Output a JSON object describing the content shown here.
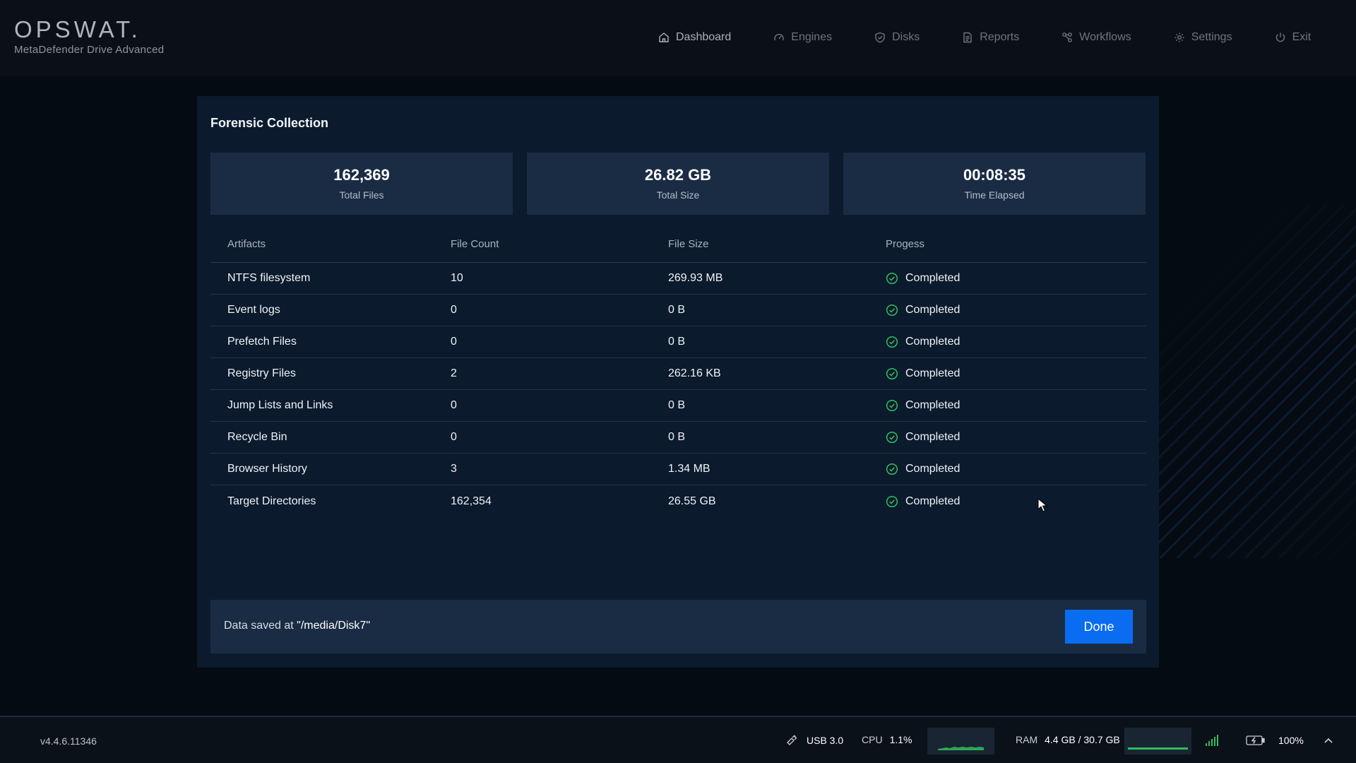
{
  "brand": {
    "logo": "OPSWAT.",
    "product": "MetaDefender Drive Advanced"
  },
  "nav": [
    {
      "label": "Dashboard",
      "icon": "home-icon"
    },
    {
      "label": "Engines",
      "icon": "gauge-icon"
    },
    {
      "label": "Disks",
      "icon": "shield-check-icon"
    },
    {
      "label": "Reports",
      "icon": "document-icon"
    },
    {
      "label": "Workflows",
      "icon": "workflow-icon"
    },
    {
      "label": "Settings",
      "icon": "gear-icon"
    },
    {
      "label": "Exit",
      "icon": "power-icon"
    }
  ],
  "panel": {
    "title": "Forensic Collection",
    "stats": [
      {
        "value": "162,369",
        "label": "Total Files"
      },
      {
        "value": "26.82 GB",
        "label": "Total Size"
      },
      {
        "value": "00:08:35",
        "label": "Time Elapsed"
      }
    ],
    "columns": [
      "Artifacts",
      "File Count",
      "File Size",
      "Progess"
    ],
    "rows": [
      {
        "artifact": "NTFS filesystem",
        "count": "10",
        "size": "269.93 MB",
        "status": "Completed"
      },
      {
        "artifact": "Event logs",
        "count": "0",
        "size": "0 B",
        "status": "Completed"
      },
      {
        "artifact": "Prefetch Files",
        "count": "0",
        "size": "0 B",
        "status": "Completed"
      },
      {
        "artifact": "Registry Files",
        "count": "2",
        "size": "262.16 KB",
        "status": "Completed"
      },
      {
        "artifact": "Jump Lists and Links",
        "count": "0",
        "size": "0 B",
        "status": "Completed"
      },
      {
        "artifact": "Recycle Bin",
        "count": "0",
        "size": "0 B",
        "status": "Completed"
      },
      {
        "artifact": "Browser History",
        "count": "3",
        "size": "1.34 MB",
        "status": "Completed"
      },
      {
        "artifact": "Target Directories",
        "count": "162,354",
        "size": "26.55 GB",
        "status": "Completed"
      }
    ],
    "saved_prefix": "Data saved at ",
    "saved_path": "\"/media/Disk7\"",
    "done_label": "Done"
  },
  "statusbar": {
    "version": "v4.4.6.11346",
    "usb": "USB 3.0",
    "cpu_label": "CPU",
    "cpu_value": "1.1%",
    "ram_label": "RAM",
    "ram_value": "4.4 GB / 30.7 GB",
    "battery": "100%"
  },
  "colors": {
    "accent": "#0a6cf0",
    "success": "#2fbf5b",
    "panel": "#0b1a2d",
    "card": "#1a2c44"
  }
}
